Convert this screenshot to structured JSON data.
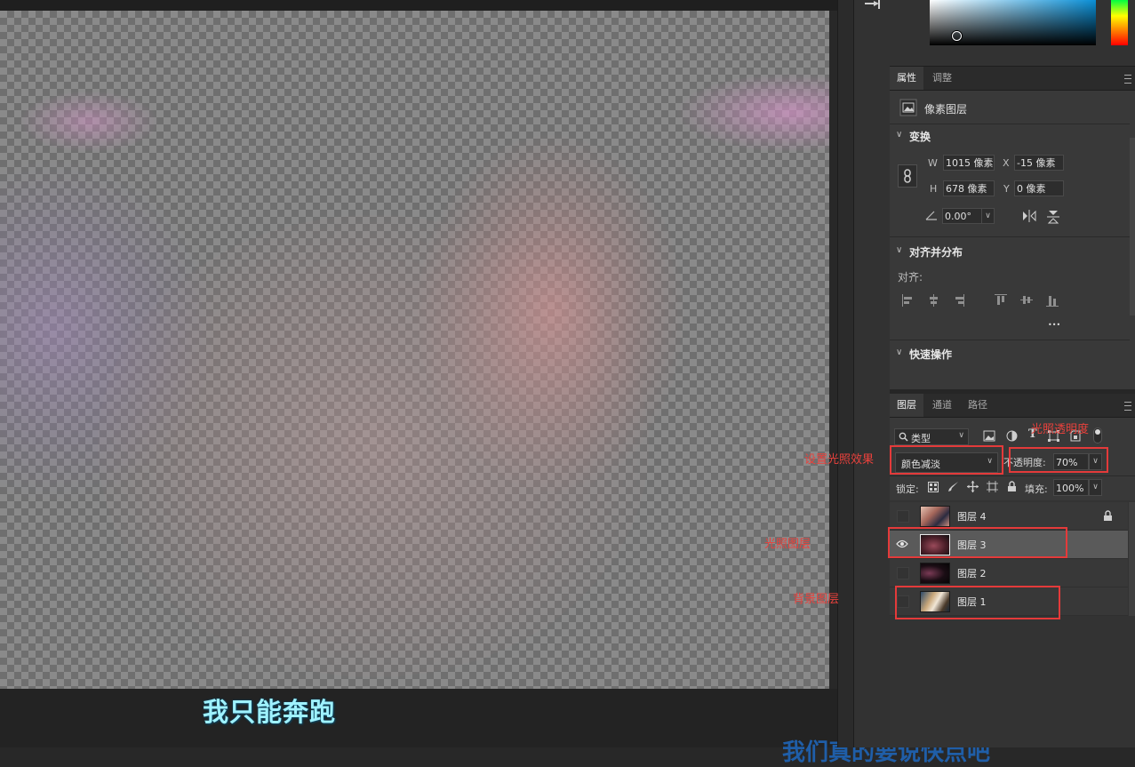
{
  "canvas": {
    "subtitle": "我只能奔跑",
    "bottom_caption": "我们真的要说快点吧"
  },
  "colors": {
    "accent_red": "#e43a3a",
    "subtitle_cyan": "#9ff2ff",
    "panel_bg": "#393939"
  },
  "properties_panel": {
    "tabs": [
      {
        "label": "属性",
        "active": true
      },
      {
        "label": "调整",
        "active": false
      }
    ],
    "layer_kind_label": "像素图层",
    "transform": {
      "title": "变换",
      "w_label": "W",
      "w_value": "1015 像素",
      "x_label": "X",
      "x_value": "-15 像素",
      "h_label": "H",
      "h_value": "678 像素",
      "y_label": "Y",
      "y_value": "0 像素",
      "angle_value": "0.00°"
    },
    "align": {
      "title": "对齐并分布",
      "sub_label": "对齐:",
      "more": "•••"
    },
    "quick_actions": {
      "title": "快速操作"
    }
  },
  "layers_panel": {
    "tabs": [
      {
        "label": "图层",
        "active": true
      },
      {
        "label": "通道",
        "active": false
      },
      {
        "label": "路径",
        "active": false
      }
    ],
    "filter_label": "类型",
    "blend_mode": "颜色减淡",
    "opacity_label": "不透明度:",
    "opacity_value": "70%",
    "lock_label": "锁定:",
    "fill_label": "填充:",
    "fill_value": "100%",
    "layers": [
      {
        "name": "图层 4",
        "visible": false,
        "locked": true,
        "selected": false
      },
      {
        "name": "图层 3",
        "visible": true,
        "locked": false,
        "selected": true
      },
      {
        "name": "图层 2",
        "visible": false,
        "locked": false,
        "selected": false
      },
      {
        "name": "图层 1",
        "visible": false,
        "locked": false,
        "selected": false
      }
    ]
  },
  "annotations": {
    "opacity_note": "光照透明度",
    "blend_note": "设置光照效果",
    "light_layer_note": "光照图层",
    "background_layer_note": "背景图层"
  }
}
